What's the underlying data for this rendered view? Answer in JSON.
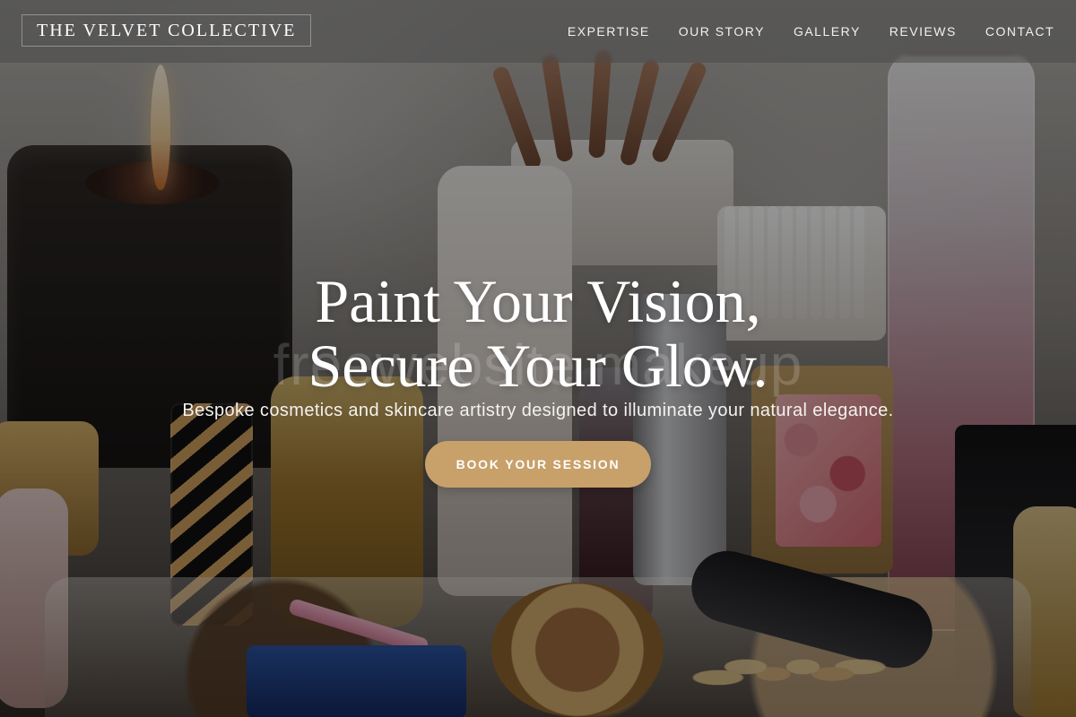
{
  "header": {
    "brand": "THE VELVET COLLECTIVE",
    "nav": [
      {
        "label": "EXPERTISE"
      },
      {
        "label": "OUR STORY"
      },
      {
        "label": "GALLERY"
      },
      {
        "label": "REVIEWS"
      },
      {
        "label": "CONTACT"
      }
    ]
  },
  "hero": {
    "title": "Paint Your Vision,\nSecure Your Glow.",
    "subtitle": "Bespoke cosmetics and skincare artistry designed to illuminate your natural elegance.",
    "cta": "BOOK YOUR SESSION",
    "watermark": "freewebsite makeup"
  },
  "colors": {
    "accent": "#c8a06a",
    "text_light": "#ffffff",
    "header_overlay": "#484848"
  }
}
